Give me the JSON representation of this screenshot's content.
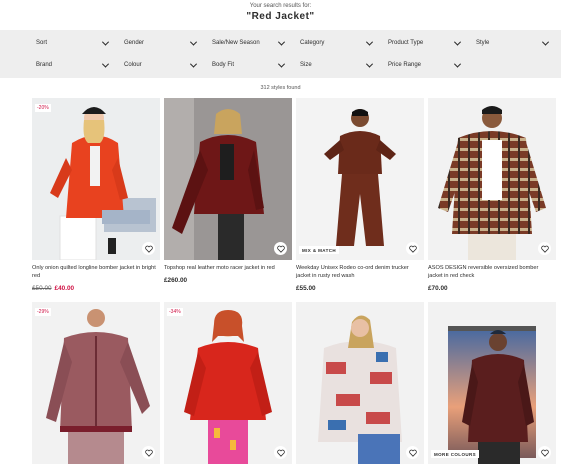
{
  "search": {
    "subtitle": "Your search results for:",
    "term": "\"Red Jacket\""
  },
  "filters": [
    "Sort",
    "Gender",
    "Sale/New Season",
    "Category",
    "Product Type",
    "Style",
    "Brand",
    "Colour",
    "Body Fit",
    "Size",
    "Price Range"
  ],
  "results_count": "312 styles found",
  "products": [
    {
      "badge": "-20%",
      "tag": "",
      "title": "Only onion quilted longline bomber jacket in bright red",
      "old_price": "£50.00",
      "price": "£40.00"
    },
    {
      "badge": "",
      "tag": "",
      "title": "Topshop real leather moto racer jacket in red",
      "old_price": "",
      "price": "£260.00"
    },
    {
      "badge": "",
      "tag": "MIX & MATCH",
      "title": "Weekday Unisex Rodeo co-ord denim trucker jacket in rusty red wash",
      "old_price": "",
      "price": "£55.00"
    },
    {
      "badge": "",
      "tag": "",
      "title": "ASOS DESIGN reversible oversized bomber jacket in red check",
      "old_price": "",
      "price": "£70.00"
    },
    {
      "badge": "-29%",
      "tag": "",
      "title": "",
      "old_price": "",
      "price": ""
    },
    {
      "badge": "-34%",
      "tag": "",
      "title": "",
      "old_price": "",
      "price": ""
    },
    {
      "badge": "",
      "tag": "",
      "title": "",
      "old_price": "",
      "price": ""
    },
    {
      "badge": "",
      "tag": "MORE COLOURS",
      "title": "",
      "old_price": "",
      "price": ""
    }
  ],
  "colors": {
    "sale": "#d01345",
    "filter_bg": "#eeeeee",
    "text": "#2d2d2d"
  },
  "icons": {
    "heart": "heart-icon",
    "chevron": "chevron-down-icon"
  }
}
